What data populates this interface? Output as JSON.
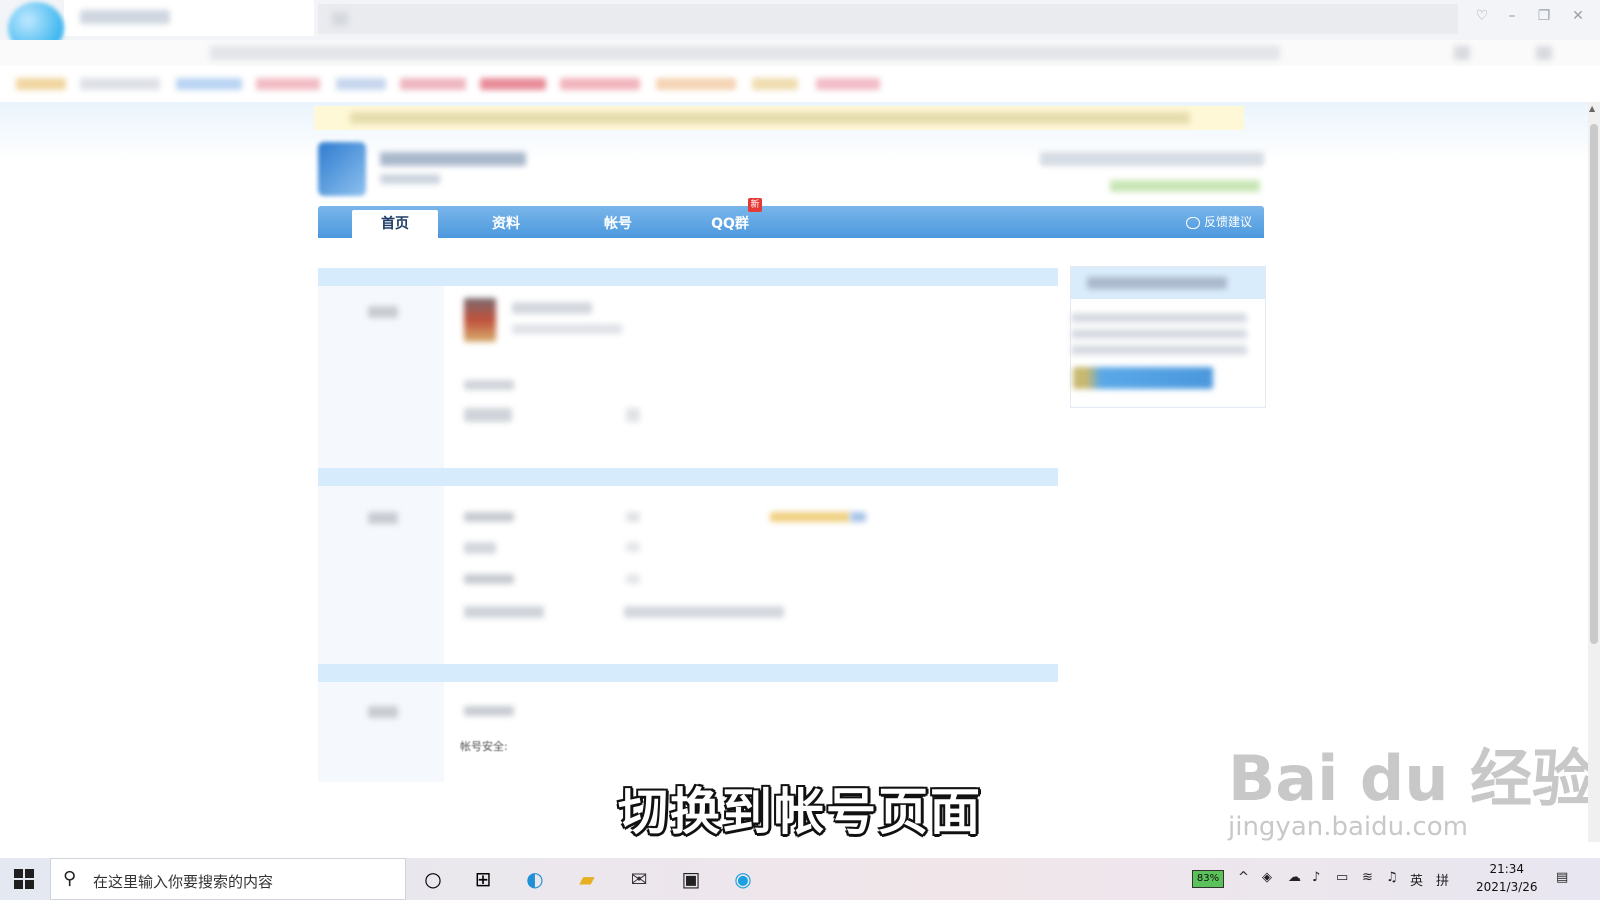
{
  "nav": {
    "tabs": [
      {
        "label": "首页",
        "active": true
      },
      {
        "label": "资料",
        "active": false
      },
      {
        "label": "帐号",
        "active": false
      },
      {
        "label": "QQ群",
        "active": false
      }
    ],
    "new_badge": "新",
    "feedback_label": "反馈建议"
  },
  "content": {
    "account_security_label": "帐号安全:"
  },
  "subtitle": "切换到帐号页面",
  "watermark": {
    "brand": "Bai du 经验",
    "url": "jingyan.baidu.com"
  },
  "taskbar": {
    "search_placeholder": "在这里输入你要搜索的内容",
    "battery": "83%",
    "input_lang": "英",
    "input_mode": "拼",
    "time": "21:34",
    "date": "2021/3/26"
  },
  "colors": {
    "nav_blue": "#4c98dd",
    "section_head": "#d6ebfb",
    "badge_red": "#e53935"
  }
}
